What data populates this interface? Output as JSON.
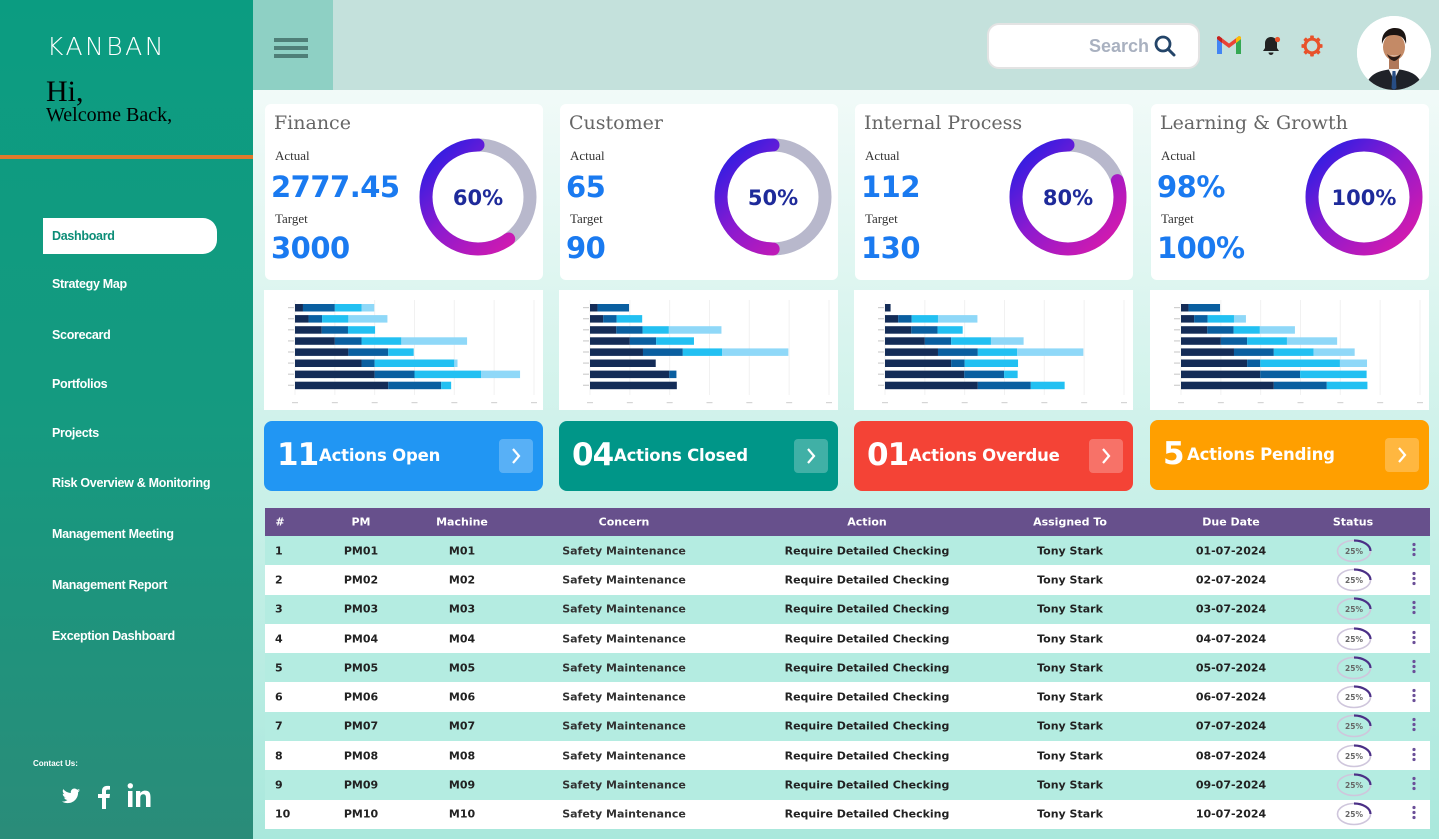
{
  "sidebar": {
    "brand": "KANBAN",
    "greeting": "Hi,",
    "welcome": "Welcome Back,",
    "items": [
      {
        "label": "Dashboard",
        "active": true
      },
      {
        "label": "Strategy Map",
        "active": false
      },
      {
        "label": "Scorecard",
        "active": false
      },
      {
        "label": "Portfolios",
        "active": false
      },
      {
        "label": "Projects",
        "active": false
      },
      {
        "label": "Risk Overview & Monitoring",
        "active": false
      },
      {
        "label": "Management Meeting",
        "active": false
      },
      {
        "label": "Management Report",
        "active": false
      },
      {
        "label": "Exception Dashboard",
        "active": false
      }
    ],
    "contact_label": "Contact Us:",
    "social": [
      "twitter-icon",
      "facebook-icon",
      "linkedin-icon"
    ]
  },
  "header": {
    "search_placeholder": "Search",
    "icons": [
      "gmail-icon",
      "bell-icon",
      "gear-icon"
    ],
    "colors": {
      "bell_badge": "#e8522b",
      "gear": "#e8522b"
    }
  },
  "kpis": [
    {
      "title": "Finance",
      "actual_label": "Actual",
      "actual": "2777.45",
      "target_label": "Target",
      "target": "3000",
      "percent": 60,
      "percent_label": "60%"
    },
    {
      "title": "Customer",
      "actual_label": "Actual",
      "actual": "65",
      "target_label": "Target",
      "target": "90",
      "percent": 50,
      "percent_label": "50%"
    },
    {
      "title": "Internal Process",
      "actual_label": "Actual",
      "actual": "112",
      "target_label": "Target",
      "target": "130",
      "percent": 80,
      "percent_label": "80%"
    },
    {
      "title": "Learning & Growth",
      "actual_label": "Actual",
      "actual": "98%",
      "target_label": "Target",
      "target": "100%",
      "percent": 100,
      "percent_label": "100%"
    }
  ],
  "chart_data": [
    {
      "type": "bar",
      "orientation": "horizontal",
      "stacked": true,
      "title": "",
      "xlabel": "",
      "ylabel": "",
      "xlim": [
        0,
        600
      ],
      "grid": true,
      "series_colors": [
        "#142c57",
        "#0a5fa0",
        "#22c0f2",
        "#8fd8f8"
      ],
      "rows": [
        [
          20,
          80,
          67,
          32
        ],
        [
          34,
          34,
          66,
          98
        ],
        [
          67,
          66,
          68,
          0
        ],
        [
          100,
          67,
          100,
          165
        ],
        [
          134,
          100,
          64,
          0
        ],
        [
          167,
          33,
          200,
          8
        ],
        [
          200,
          100,
          167,
          98
        ],
        [
          234,
          133,
          25,
          0
        ]
      ]
    },
    {
      "type": "bar",
      "orientation": "horizontal",
      "stacked": true,
      "title": "",
      "xlabel": "",
      "ylabel": "",
      "xlim": [
        0,
        600
      ],
      "grid": true,
      "series_colors": [
        "#142c57",
        "#0a5fa0",
        "#22c0f2",
        "#8fd8f8"
      ],
      "rows": [
        [
          19,
          79,
          0,
          0
        ],
        [
          33,
          34,
          64,
          0
        ],
        [
          66,
          66,
          66,
          132
        ],
        [
          100,
          66,
          95,
          0
        ],
        [
          133,
          100,
          99,
          166
        ],
        [
          165,
          0,
          0,
          0
        ],
        [
          199,
          18,
          0,
          0
        ],
        [
          218,
          0,
          0,
          0
        ]
      ]
    },
    {
      "type": "bar",
      "orientation": "horizontal",
      "stacked": true,
      "title": "",
      "xlabel": "",
      "ylabel": "",
      "xlim": [
        0,
        600
      ],
      "grid": true,
      "series_colors": [
        "#142c57",
        "#0a5fa0",
        "#22c0f2",
        "#8fd8f8"
      ],
      "rows": [
        [
          14,
          0,
          0,
          0
        ],
        [
          33,
          34,
          66,
          99
        ],
        [
          66,
          66,
          63,
          0
        ],
        [
          100,
          66,
          100,
          82
        ],
        [
          133,
          100,
          99,
          166
        ],
        [
          166,
          34,
          134,
          0
        ],
        [
          199,
          100,
          34,
          0
        ],
        [
          233,
          133,
          85,
          0
        ]
      ]
    },
    {
      "type": "bar",
      "orientation": "horizontal",
      "stacked": true,
      "title": "",
      "xlabel": "",
      "ylabel": "",
      "xlim": [
        0,
        600
      ],
      "grid": true,
      "series_colors": [
        "#142c57",
        "#0a5fa0",
        "#22c0f2",
        "#8fd8f8"
      ],
      "rows": [
        [
          19,
          79,
          0,
          0
        ],
        [
          33,
          34,
          66,
          30
        ],
        [
          66,
          66,
          66,
          88
        ],
        [
          100,
          66,
          100,
          126
        ],
        [
          133,
          100,
          100,
          103
        ],
        [
          166,
          33,
          200,
          68
        ],
        [
          199,
          100,
          167,
          0
        ],
        [
          233,
          133,
          102,
          0
        ]
      ]
    }
  ],
  "actions": [
    {
      "count": "11",
      "label": "Actions Open",
      "color": "#2196f3"
    },
    {
      "count": "04",
      "label": "Actions Closed",
      "color": "#009688"
    },
    {
      "count": "01",
      "label": "Actions Overdue",
      "color": "#f44336"
    },
    {
      "count": "5",
      "label": "Actions Pending",
      "color": "#ff9f00"
    }
  ],
  "table": {
    "headers": [
      "#",
      "PM",
      "Machine",
      "Concern",
      "Action",
      "Assigned To",
      "Due Date",
      "Status"
    ],
    "rows": [
      {
        "n": "1",
        "pm": "PM01",
        "machine": "M01",
        "concern": "Safety Maintenance",
        "action": "Require Detailed Checking",
        "assigned": "Tony Stark",
        "due": "01-07-2024",
        "status": "25%",
        "progress": 25
      },
      {
        "n": "2",
        "pm": "PM02",
        "machine": "M02",
        "concern": "Safety Maintenance",
        "action": "Require Detailed Checking",
        "assigned": "Tony Stark",
        "due": "02-07-2024",
        "status": "25%",
        "progress": 25
      },
      {
        "n": "3",
        "pm": "PM03",
        "machine": "M03",
        "concern": "Safety Maintenance",
        "action": "Require Detailed Checking",
        "assigned": "Tony Stark",
        "due": "03-07-2024",
        "status": "25%",
        "progress": 25
      },
      {
        "n": "4",
        "pm": "PM04",
        "machine": "M04",
        "concern": "Safety Maintenance",
        "action": "Require Detailed Checking",
        "assigned": "Tony Stark",
        "due": "04-07-2024",
        "status": "25%",
        "progress": 25
      },
      {
        "n": "5",
        "pm": "PM05",
        "machine": "M05",
        "concern": "Safety Maintenance",
        "action": "Require Detailed Checking",
        "assigned": "Tony Stark",
        "due": "05-07-2024",
        "status": "25%",
        "progress": 25
      },
      {
        "n": "6",
        "pm": "PM06",
        "machine": "M06",
        "concern": "Safety Maintenance",
        "action": "Require Detailed Checking",
        "assigned": "Tony Stark",
        "due": "06-07-2024",
        "status": "25%",
        "progress": 25
      },
      {
        "n": "7",
        "pm": "PM07",
        "machine": "M07",
        "concern": "Safety Maintenance",
        "action": "Require Detailed Checking",
        "assigned": "Tony Stark",
        "due": "07-07-2024",
        "status": "25%",
        "progress": 25
      },
      {
        "n": "8",
        "pm": "PM08",
        "machine": "M08",
        "concern": "Safety Maintenance",
        "action": "Require Detailed Checking",
        "assigned": "Tony Stark",
        "due": "08-07-2024",
        "status": "25%",
        "progress": 25
      },
      {
        "n": "9",
        "pm": "PM09",
        "machine": "M09",
        "concern": "Safety Maintenance",
        "action": "Require Detailed Checking",
        "assigned": "Tony Stark",
        "due": "09-07-2024",
        "status": "25%",
        "progress": 25
      },
      {
        "n": "10",
        "pm": "PM10",
        "machine": "M10",
        "concern": "Safety Maintenance",
        "action": "Require Detailed Checking",
        "assigned": "Tony Stark",
        "due": "10-07-2024",
        "status": "25%",
        "progress": 25
      }
    ]
  }
}
